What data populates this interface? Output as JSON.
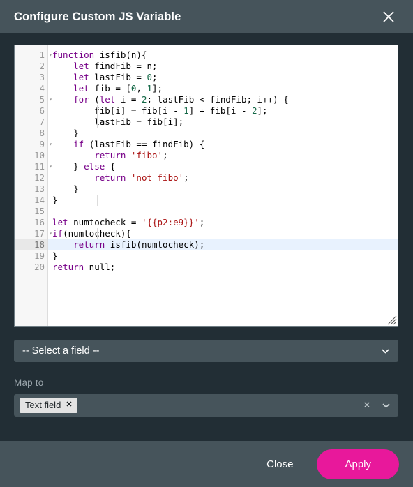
{
  "dialog": {
    "title": "Configure Custom JS Variable",
    "close_icon": "close-icon"
  },
  "editor": {
    "language": "javascript",
    "active_line": 18,
    "line_numbers": [
      1,
      2,
      3,
      4,
      5,
      6,
      7,
      8,
      9,
      10,
      11,
      12,
      13,
      14,
      15,
      16,
      17,
      18,
      19,
      20
    ],
    "folded_markers": [
      1,
      5,
      9,
      11,
      17
    ],
    "lines": [
      "function isfib(n){",
      "    let findFib = n;",
      "    let lastFib = 0;",
      "    let fib = [0, 1];",
      "    for (let i = 2; lastFib < findFib; i++) {",
      "        fib[i] = fib[i - 1] + fib[i - 2];",
      "        lastFib = fib[i];",
      "    }",
      "    if (lastFib == findFib) {",
      "        return 'fibo';",
      "    } else {",
      "        return 'not fibo';",
      "    }",
      "}",
      "",
      "let numtocheck = '{{p2:e9}}';",
      "if(numtocheck){",
      "    return isfib(numtocheck);",
      "}",
      "return null;"
    ],
    "resize_handle": "resize-grip-icon"
  },
  "field_select": {
    "value": "-- Select a field --",
    "chevron_icon": "chevron-down-icon"
  },
  "map_to": {
    "label": "Map to",
    "tags": [
      {
        "label": "Text field",
        "remove_icon": "close-icon"
      }
    ],
    "clear_icon": "clear-icon",
    "chevron_icon": "chevron-down-icon"
  },
  "footer": {
    "close_label": "Close",
    "apply_label": "Apply"
  },
  "colors": {
    "titlebar": "#46545b",
    "body": "#222e35",
    "footer": "#46545b",
    "apply_button": "#e8189b",
    "field_bg": "#46545b",
    "editor_bg": "#ffffff",
    "active_line": "#e8f2fe",
    "keyword": "#770088",
    "string": "#aa1111",
    "number": "#116644"
  }
}
